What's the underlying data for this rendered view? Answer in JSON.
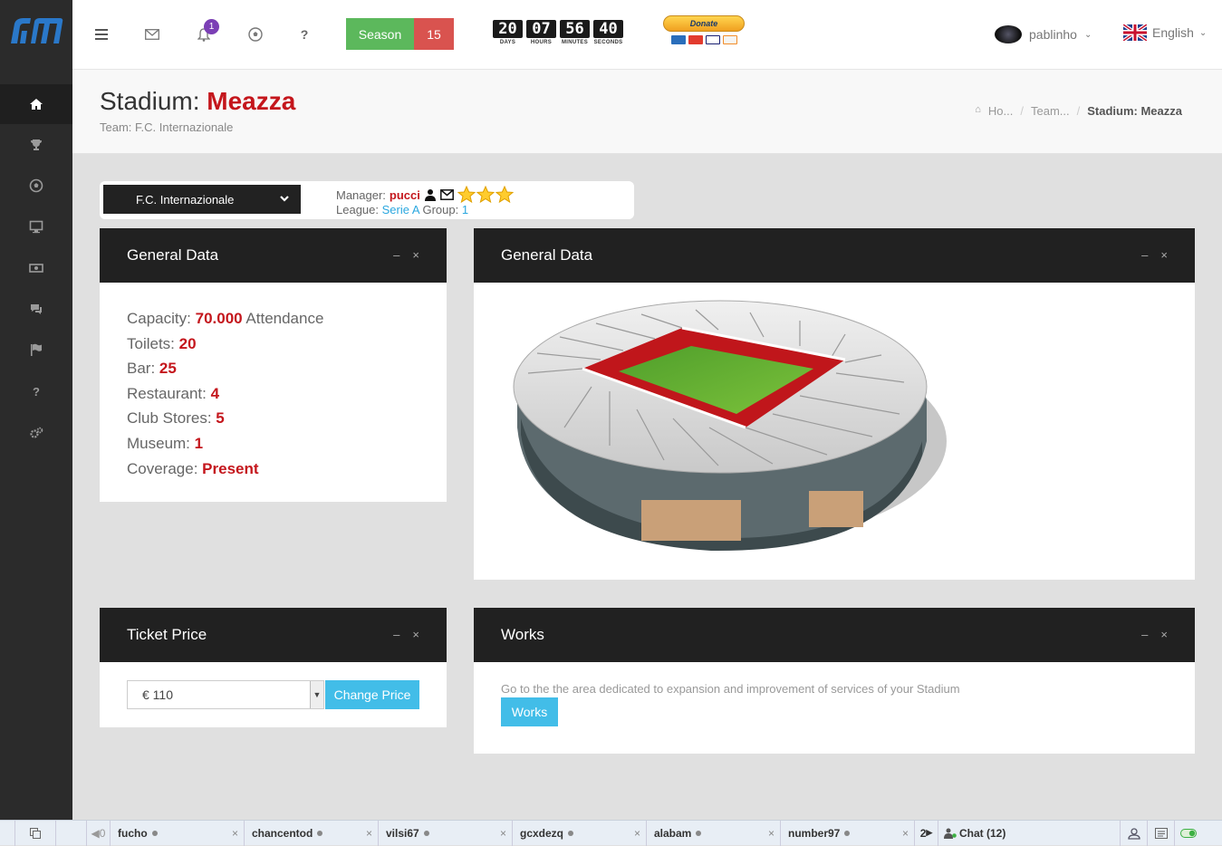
{
  "topbar": {
    "notification_count": "1",
    "season_label": "Season",
    "season_number": "15",
    "countdown": [
      {
        "value": "20",
        "unit": "DAYS"
      },
      {
        "value": "07",
        "unit": "HOURS"
      },
      {
        "value": "56",
        "unit": "MINUTES"
      },
      {
        "value": "40",
        "unit": "SECONDS"
      }
    ],
    "donate_label": "Donate",
    "username": "pablinho",
    "language": "English"
  },
  "header": {
    "title_prefix": "Stadium:",
    "title_name": "Meazza",
    "subtitle": "Team: F.C. Internazionale",
    "breadcrumb": [
      "Ho...",
      "Team...",
      "Stadium: Meazza"
    ]
  },
  "teambar": {
    "team": "F.C. Internazionale",
    "manager_label": "Manager:",
    "manager": "pucci",
    "league_label": "League:",
    "league": "Serie A",
    "group_label": "Group:",
    "group": "1",
    "stars": 3
  },
  "general": {
    "title": "General Data",
    "rows": [
      {
        "label": "Capacity:",
        "value": "70.000",
        "suffix": "Attendance"
      },
      {
        "label": "Toilets:",
        "value": "20",
        "suffix": ""
      },
      {
        "label": "Bar:",
        "value": "25",
        "suffix": ""
      },
      {
        "label": "Restaurant:",
        "value": "4",
        "suffix": ""
      },
      {
        "label": "Club Stores:",
        "value": "5",
        "suffix": ""
      },
      {
        "label": "Museum:",
        "value": "1",
        "suffix": ""
      },
      {
        "label": "Coverage:",
        "value": "Present",
        "suffix": ""
      }
    ]
  },
  "image_panel": {
    "title": "General Data"
  },
  "ticket": {
    "title": "Ticket Price",
    "price": "€ 110",
    "button": "Change Price"
  },
  "works": {
    "title": "Works",
    "description": "Go to the the area dedicated to expansion and improvement of services of your Stadium",
    "button": "Works"
  },
  "panel_controls": {
    "minimize": "–",
    "close": "×"
  },
  "chatbar": {
    "users": [
      "fucho",
      "chancentod",
      "vilsi67",
      "gcxdezq",
      "alabam",
      "number97"
    ],
    "page": "2",
    "chat_label": "Chat (12)",
    "left_counter": "0"
  },
  "colors": {
    "accent_red": "#c4161c",
    "accent_blue": "#42bde8",
    "season_green": "#5cb85c",
    "season_red": "#d9534f",
    "dark": "#212121"
  }
}
